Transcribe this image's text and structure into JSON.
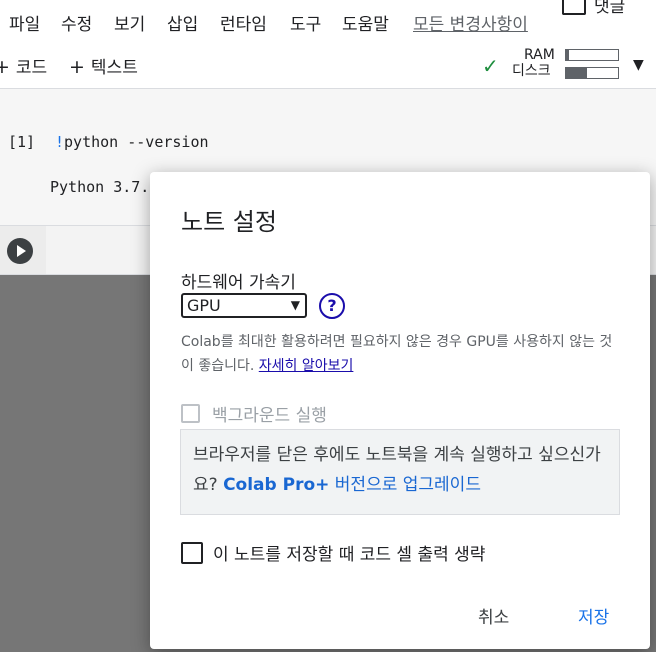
{
  "menu": {
    "items": [
      "파일",
      "수정",
      "보기",
      "삽입",
      "런타임",
      "도구",
      "도움말"
    ],
    "all_changes": "모든 변경사항이"
  },
  "comment_label": "댓글",
  "toolbar": {
    "code_label": "코드",
    "text_label": "텍스트",
    "ram_label": "RAM",
    "disk_label": "디스크",
    "ram_usage": 0.05,
    "disk_usage": 0.4
  },
  "cell": {
    "prompt": "[1]",
    "bang": "!",
    "code": "python --version",
    "output": "Python 3.7."
  },
  "dialog": {
    "title": "노트 설정",
    "accelerator_label": "하드웨어 가속기",
    "accelerator_value": "GPU",
    "help_symbol": "?",
    "description": "Colab를 최대한 활용하려면 필요하지 않은 경우 GPU를 사용하지 않는 것이 좋습니다.",
    "learn_more": "자세히 알아보기",
    "background_label": "백그라운드 실행",
    "promo_text": "브라우저를 닫은 후에도 노트북을 계속 실행하고 싶으신가요?",
    "promo_pro": "Colab Pro+",
    "promo_upgrade": "버전으로 업그레이드",
    "omit_output_label": "이 노트를 저장할 때 코드 셀 출력 생략",
    "cancel_label": "취소",
    "save_label": "저장"
  },
  "colors": {
    "accent": "#1a73e8",
    "link": "#1a0dab",
    "success": "#1e8e3e"
  }
}
